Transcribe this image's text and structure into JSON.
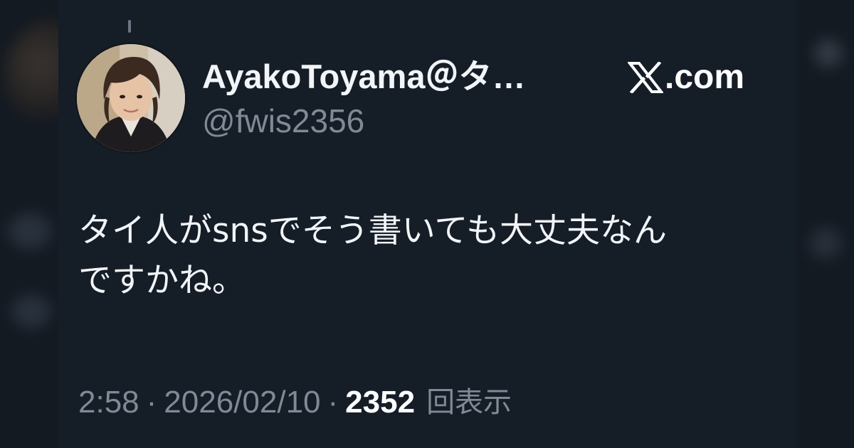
{
  "header": {
    "display_name": "AyakoToyama＠タ…",
    "handle": "@fwis2356",
    "brand": ".com"
  },
  "tweet": {
    "text": "タイ人がsnsでそう書いても大丈夫なん\nですかね。"
  },
  "meta": {
    "time": "2:58",
    "separator": "·",
    "date": "2026/02/10",
    "views_count": "2352",
    "views_label": "回表示"
  },
  "colors": {
    "background": "#151d27",
    "text": "#f2f5f7",
    "muted": "#7f8a96"
  },
  "icons": {
    "brand": "x-logo-icon",
    "avatar": "profile-photo"
  }
}
